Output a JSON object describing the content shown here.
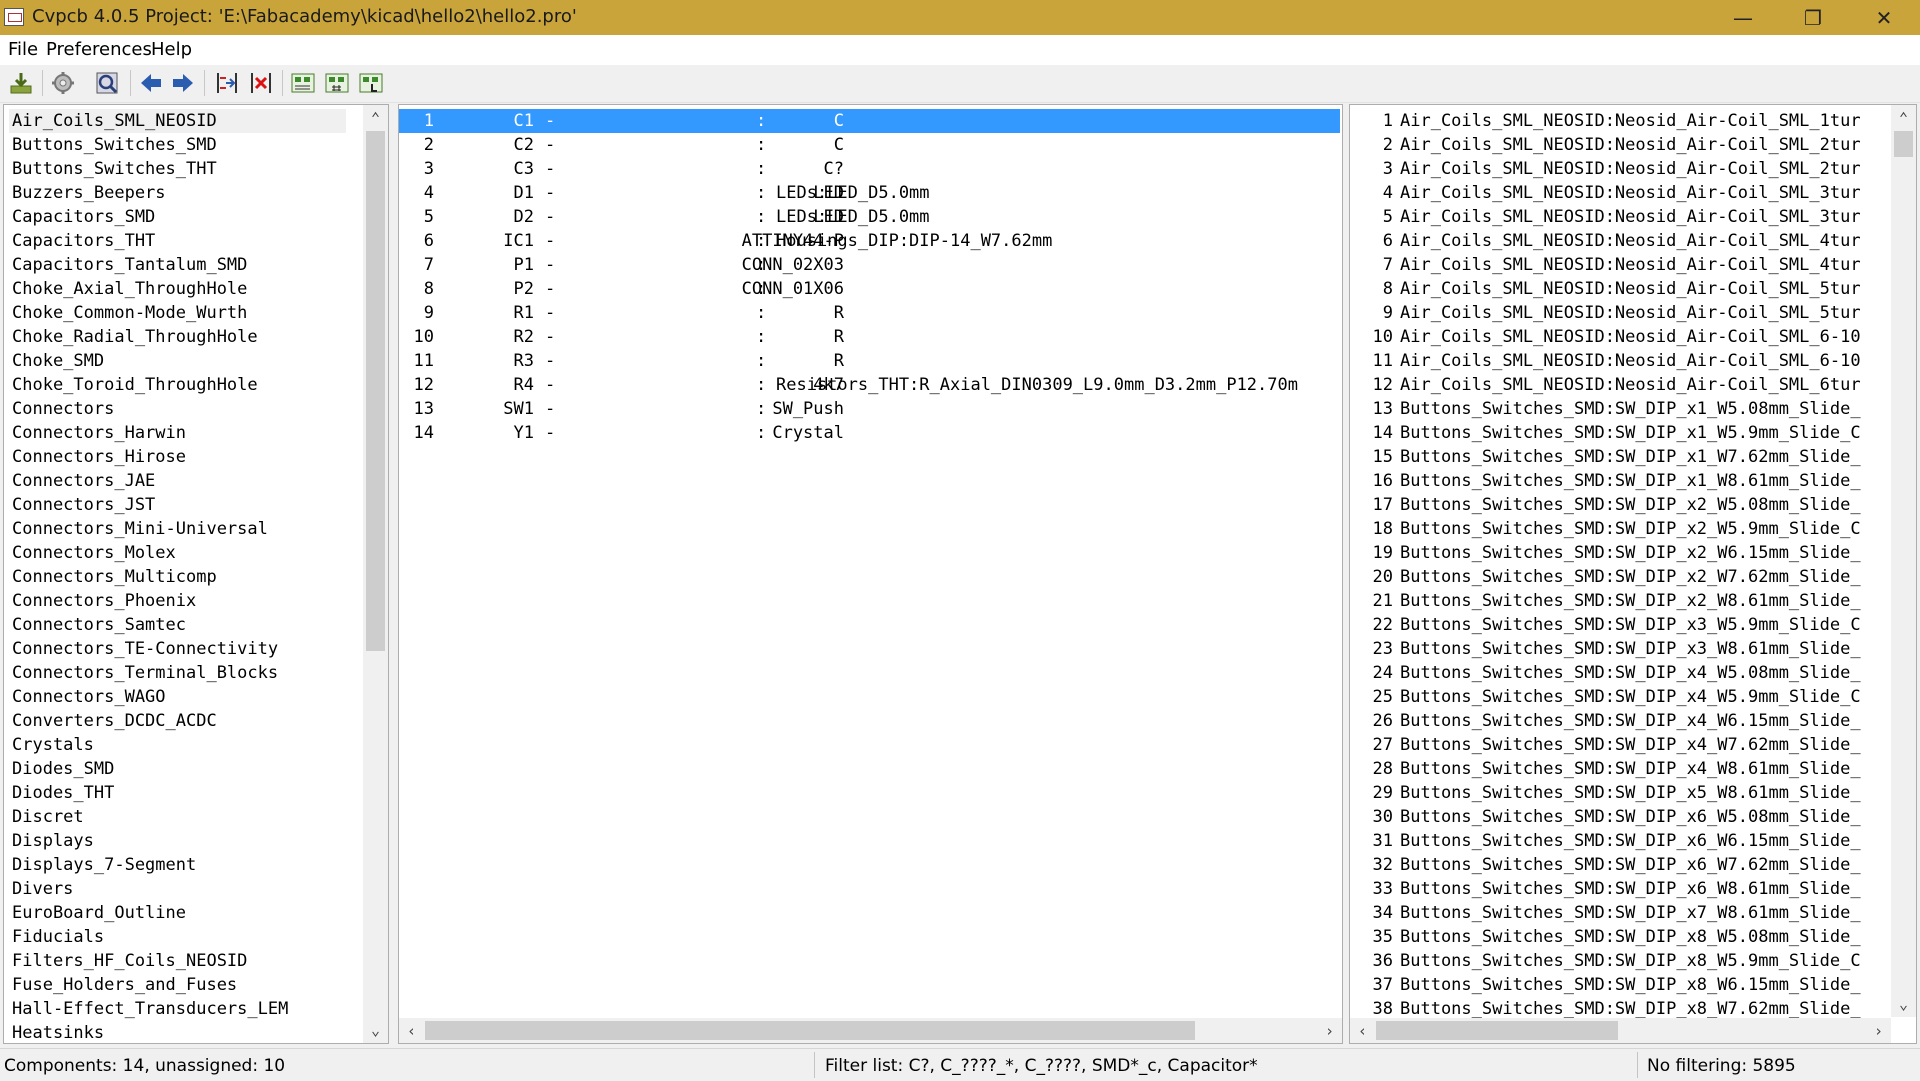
{
  "window": {
    "title": "Cvpcb 4.0.5  Project: 'E:\\Fabacademy\\kicad\\hello2\\hello2.pro'",
    "minimize": "—",
    "restore": "❐",
    "close": "✕"
  },
  "menu": [
    "File",
    "Preferences",
    "Help"
  ],
  "toolbar": [
    "save-netlist-icon",
    "settings-icon",
    "view-footprint-icon",
    "previous-icon",
    "next-icon",
    "auto-associate-icon",
    "delete-associations-icon",
    "filter-keywords-icon",
    "filter-pincount-icon",
    "filter-library-icon"
  ],
  "libraries": [
    "Air_Coils_SML_NEOSID",
    "Buttons_Switches_SMD",
    "Buttons_Switches_THT",
    "Buzzers_Beepers",
    "Capacitors_SMD",
    "Capacitors_THT",
    "Capacitors_Tantalum_SMD",
    "Choke_Axial_ThroughHole",
    "Choke_Common-Mode_Wurth",
    "Choke_Radial_ThroughHole",
    "Choke_SMD",
    "Choke_Toroid_ThroughHole",
    "Connectors",
    "Connectors_Harwin",
    "Connectors_Hirose",
    "Connectors_JAE",
    "Connectors_JST",
    "Connectors_Mini-Universal",
    "Connectors_Molex",
    "Connectors_Multicomp",
    "Connectors_Phoenix",
    "Connectors_Samtec",
    "Connectors_TE-Connectivity",
    "Connectors_Terminal_Blocks",
    "Connectors_WAGO",
    "Converters_DCDC_ACDC",
    "Crystals",
    "Diodes_SMD",
    "Diodes_THT",
    "Discret",
    "Displays",
    "Displays_7-Segment",
    "Divers",
    "EuroBoard_Outline",
    "Fiducials",
    "Filters_HF_Coils_NEOSID",
    "Fuse_Holders_and_Fuses",
    "Hall-Effect_Transducers_LEM",
    "Heatsinks"
  ],
  "components": [
    {
      "num": "1",
      "ref": "C1",
      "value": "C",
      "footprint": ""
    },
    {
      "num": "2",
      "ref": "C2",
      "value": "C",
      "footprint": ""
    },
    {
      "num": "3",
      "ref": "C3",
      "value": "C?",
      "footprint": ""
    },
    {
      "num": "4",
      "ref": "D1",
      "value": "LED",
      "footprint": "LEDs:LED_D5.0mm"
    },
    {
      "num": "5",
      "ref": "D2",
      "value": "LED",
      "footprint": "LEDs:LED_D5.0mm"
    },
    {
      "num": "6",
      "ref": "IC1",
      "value": "ATTINY44-P",
      "footprint": "Housings_DIP:DIP-14_W7.62mm"
    },
    {
      "num": "7",
      "ref": "P1",
      "value": "CONN_02X03",
      "footprint": ""
    },
    {
      "num": "8",
      "ref": "P2",
      "value": "CONN_01X06",
      "footprint": ""
    },
    {
      "num": "9",
      "ref": "R1",
      "value": "R",
      "footprint": ""
    },
    {
      "num": "10",
      "ref": "R2",
      "value": "R",
      "footprint": ""
    },
    {
      "num": "11",
      "ref": "R3",
      "value": "R",
      "footprint": ""
    },
    {
      "num": "12",
      "ref": "R4",
      "value": "4k7",
      "footprint": "Resistors_THT:R_Axial_DIN0309_L9.0mm_D3.2mm_P12.70m"
    },
    {
      "num": "13",
      "ref": "SW1",
      "value": "SW_Push",
      "footprint": ""
    },
    {
      "num": "14",
      "ref": "Y1",
      "value": "Crystal",
      "footprint": ""
    }
  ],
  "footprints": [
    {
      "num": "1",
      "name": "Air_Coils_SML_NEOSID:Neosid_Air-Coil_SML_1tur"
    },
    {
      "num": "2",
      "name": "Air_Coils_SML_NEOSID:Neosid_Air-Coil_SML_2tur"
    },
    {
      "num": "3",
      "name": "Air_Coils_SML_NEOSID:Neosid_Air-Coil_SML_2tur"
    },
    {
      "num": "4",
      "name": "Air_Coils_SML_NEOSID:Neosid_Air-Coil_SML_3tur"
    },
    {
      "num": "5",
      "name": "Air_Coils_SML_NEOSID:Neosid_Air-Coil_SML_3tur"
    },
    {
      "num": "6",
      "name": "Air_Coils_SML_NEOSID:Neosid_Air-Coil_SML_4tur"
    },
    {
      "num": "7",
      "name": "Air_Coils_SML_NEOSID:Neosid_Air-Coil_SML_4tur"
    },
    {
      "num": "8",
      "name": "Air_Coils_SML_NEOSID:Neosid_Air-Coil_SML_5tur"
    },
    {
      "num": "9",
      "name": "Air_Coils_SML_NEOSID:Neosid_Air-Coil_SML_5tur"
    },
    {
      "num": "10",
      "name": "Air_Coils_SML_NEOSID:Neosid_Air-Coil_SML_6-10"
    },
    {
      "num": "11",
      "name": "Air_Coils_SML_NEOSID:Neosid_Air-Coil_SML_6-10"
    },
    {
      "num": "12",
      "name": "Air_Coils_SML_NEOSID:Neosid_Air-Coil_SML_6tur"
    },
    {
      "num": "13",
      "name": "Buttons_Switches_SMD:SW_DIP_x1_W5.08mm_Slide_"
    },
    {
      "num": "14",
      "name": "Buttons_Switches_SMD:SW_DIP_x1_W5.9mm_Slide_C"
    },
    {
      "num": "15",
      "name": "Buttons_Switches_SMD:SW_DIP_x1_W7.62mm_Slide_"
    },
    {
      "num": "16",
      "name": "Buttons_Switches_SMD:SW_DIP_x1_W8.61mm_Slide_"
    },
    {
      "num": "17",
      "name": "Buttons_Switches_SMD:SW_DIP_x2_W5.08mm_Slide_"
    },
    {
      "num": "18",
      "name": "Buttons_Switches_SMD:SW_DIP_x2_W5.9mm_Slide_C"
    },
    {
      "num": "19",
      "name": "Buttons_Switches_SMD:SW_DIP_x2_W6.15mm_Slide_"
    },
    {
      "num": "20",
      "name": "Buttons_Switches_SMD:SW_DIP_x2_W7.62mm_Slide_"
    },
    {
      "num": "21",
      "name": "Buttons_Switches_SMD:SW_DIP_x2_W8.61mm_Slide_"
    },
    {
      "num": "22",
      "name": "Buttons_Switches_SMD:SW_DIP_x3_W5.9mm_Slide_C"
    },
    {
      "num": "23",
      "name": "Buttons_Switches_SMD:SW_DIP_x3_W8.61mm_Slide_"
    },
    {
      "num": "24",
      "name": "Buttons_Switches_SMD:SW_DIP_x4_W5.08mm_Slide_"
    },
    {
      "num": "25",
      "name": "Buttons_Switches_SMD:SW_DIP_x4_W5.9mm_Slide_C"
    },
    {
      "num": "26",
      "name": "Buttons_Switches_SMD:SW_DIP_x4_W6.15mm_Slide_"
    },
    {
      "num": "27",
      "name": "Buttons_Switches_SMD:SW_DIP_x4_W7.62mm_Slide_"
    },
    {
      "num": "28",
      "name": "Buttons_Switches_SMD:SW_DIP_x4_W8.61mm_Slide_"
    },
    {
      "num": "29",
      "name": "Buttons_Switches_SMD:SW_DIP_x5_W8.61mm_Slide_"
    },
    {
      "num": "30",
      "name": "Buttons_Switches_SMD:SW_DIP_x6_W5.08mm_Slide_"
    },
    {
      "num": "31",
      "name": "Buttons_Switches_SMD:SW_DIP_x6_W6.15mm_Slide_"
    },
    {
      "num": "32",
      "name": "Buttons_Switches_SMD:SW_DIP_x6_W7.62mm_Slide_"
    },
    {
      "num": "33",
      "name": "Buttons_Switches_SMD:SW_DIP_x6_W8.61mm_Slide_"
    },
    {
      "num": "34",
      "name": "Buttons_Switches_SMD:SW_DIP_x7_W8.61mm_Slide_"
    },
    {
      "num": "35",
      "name": "Buttons_Switches_SMD:SW_DIP_x8_W5.08mm_Slide_"
    },
    {
      "num": "36",
      "name": "Buttons_Switches_SMD:SW_DIP_x8_W5.9mm_Slide_C"
    },
    {
      "num": "37",
      "name": "Buttons_Switches_SMD:SW_DIP_x8_W6.15mm_Slide_"
    },
    {
      "num": "38",
      "name": "Buttons_Switches_SMD:SW_DIP_x8_W7.62mm_Slide_"
    }
  ],
  "status": {
    "components": "Components: 14, unassigned: 10",
    "filter": "Filter list: C?, C_????_*, C_????, SMD*_c, Capacitor*",
    "filtering": "No filtering: 5895"
  },
  "colors": {
    "title_bar": "#c9a43a",
    "selection": "#3399ff"
  }
}
